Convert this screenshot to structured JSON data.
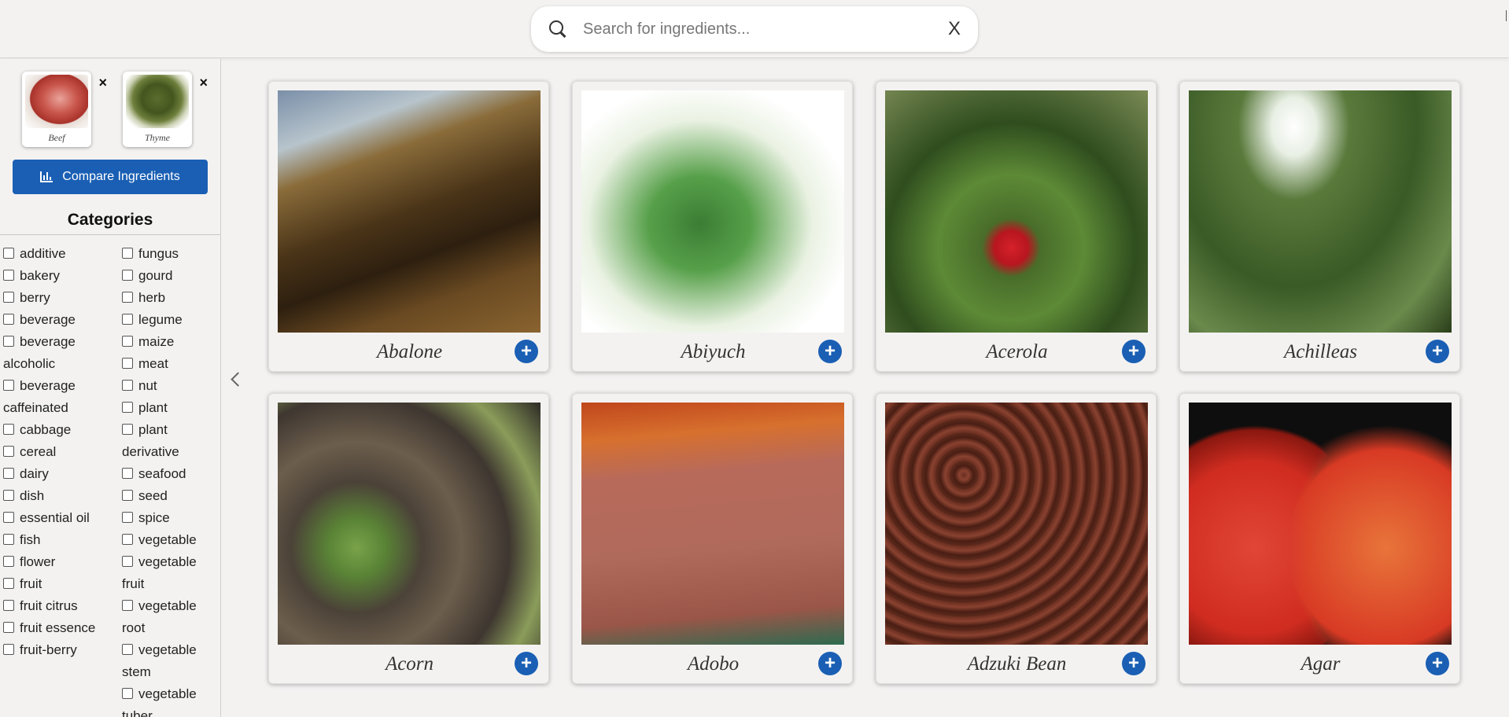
{
  "header": {
    "search_placeholder": "Search for ingredients...",
    "clear_label": "X"
  },
  "sidebar": {
    "selected": [
      {
        "label": "Beef"
      },
      {
        "label": "Thyme"
      }
    ],
    "remove_label": "×",
    "compare_label": "Compare Ingredients",
    "categories_title": "Categories",
    "categories_col1": [
      "additive",
      "bakery",
      "berry",
      "beverage",
      "beverage alcoholic",
      "beverage caffeinated",
      "cabbage",
      "cereal",
      "dairy",
      "dish",
      "essential oil",
      "fish",
      "flower",
      "fruit",
      "fruit citrus",
      "fruit essence",
      "fruit-berry"
    ],
    "categories_col2": [
      "fungus",
      "gourd",
      "herb",
      "legume",
      "maize",
      "meat",
      "nut",
      "plant",
      "plant derivative",
      "seafood",
      "seed",
      "spice",
      "vegetable",
      "vegetable fruit",
      "vegetable root",
      "vegetable stem",
      "vegetable tuber"
    ]
  },
  "ingredients": [
    {
      "name": "Abalone"
    },
    {
      "name": "Abiyuch"
    },
    {
      "name": "Acerola"
    },
    {
      "name": "Achilleas"
    },
    {
      "name": "Acorn"
    },
    {
      "name": "Adobo"
    },
    {
      "name": "Adzuki Bean"
    },
    {
      "name": "Agar"
    }
  ],
  "add_label": "+",
  "colors": {
    "accent": "#1a5fb4",
    "background": "#f3f2f1"
  }
}
